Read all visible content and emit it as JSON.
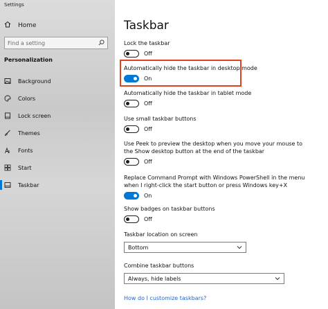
{
  "window": {
    "title": "Settings"
  },
  "sidebar": {
    "home_label": "Home",
    "search": {
      "placeholder": "Find a setting"
    },
    "section": "Personalization",
    "items": [
      {
        "label": "Background",
        "icon": "picture-icon"
      },
      {
        "label": "Colors",
        "icon": "palette-icon"
      },
      {
        "label": "Lock screen",
        "icon": "lock-screen-icon"
      },
      {
        "label": "Themes",
        "icon": "brush-icon"
      },
      {
        "label": "Fonts",
        "icon": "font-icon"
      },
      {
        "label": "Start",
        "icon": "start-icon"
      },
      {
        "label": "Taskbar",
        "icon": "taskbar-icon",
        "active": true
      }
    ]
  },
  "main": {
    "title": "Taskbar",
    "settings": [
      {
        "label": "Lock the taskbar",
        "state": "Off"
      },
      {
        "label": "Automatically hide the taskbar in desktop mode",
        "state": "On"
      },
      {
        "label": "Automatically hide the taskbar in tablet mode",
        "state": "Off"
      },
      {
        "label": "Use small taskbar buttons",
        "state": "Off"
      },
      {
        "label_line1": "Use Peek to preview the desktop when you move your mouse to",
        "label_line2": "the Show desktop button at the end of the taskbar",
        "state": "Off"
      },
      {
        "label_line1": "Replace Command Prompt with Windows PowerShell in the menu",
        "label_line2": "when I right-click the start button or press Windows key+X",
        "state": "On"
      },
      {
        "label": "Show badges on taskbar buttons",
        "state": "Off"
      }
    ],
    "location": {
      "label": "Taskbar location on screen",
      "value": "Bottom"
    },
    "combine": {
      "label": "Combine taskbar buttons",
      "value": "Always, hide labels"
    },
    "help_link": "How do I customize taskbars?"
  },
  "colors": {
    "accent": "#0078d7",
    "highlight": "#e0411f",
    "link": "#2266cc"
  }
}
